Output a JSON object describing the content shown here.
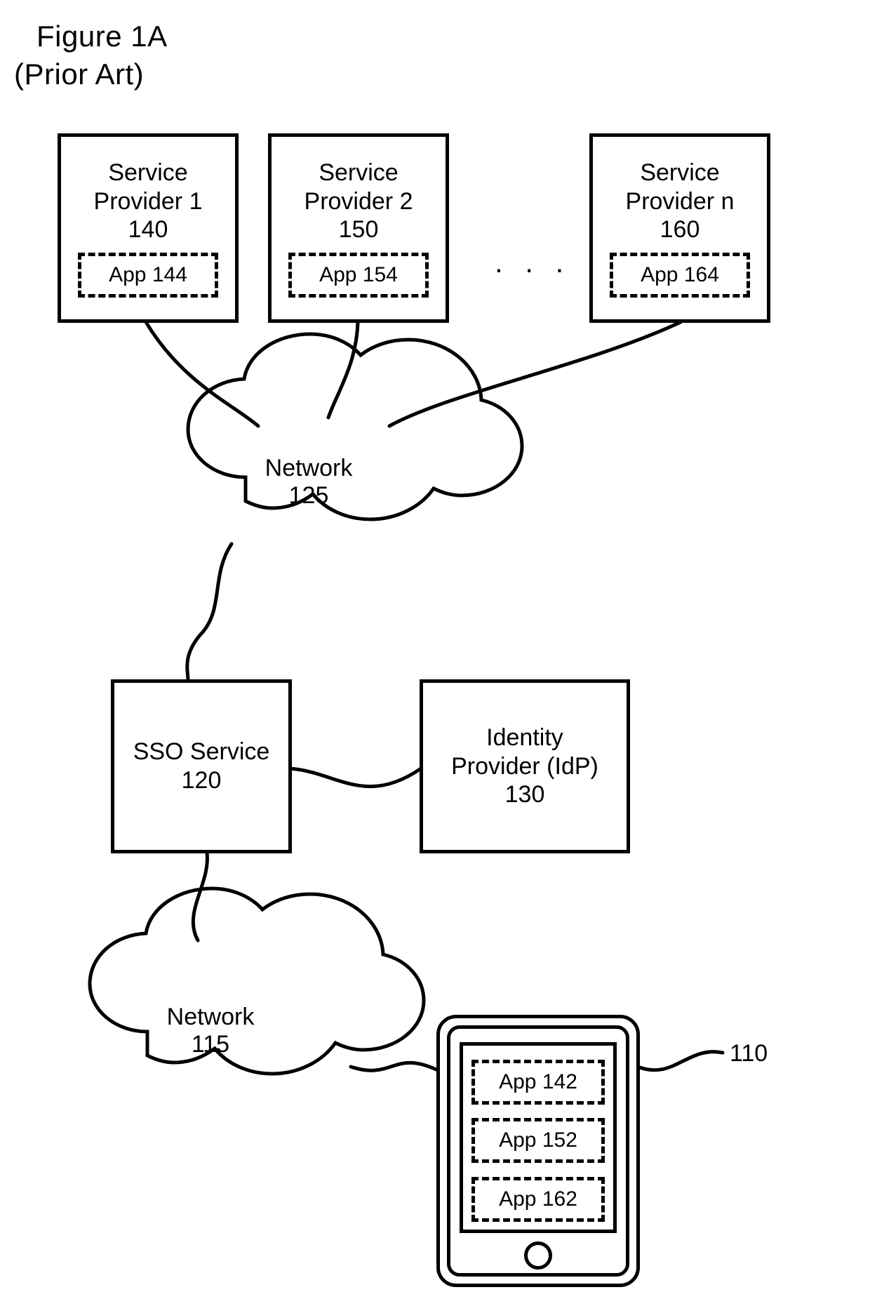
{
  "title": {
    "line1": "Figure 1A",
    "line2": "(Prior Art)"
  },
  "sp1": {
    "l1": "Service",
    "l2": "Provider 1",
    "num": "140",
    "app": "App 144"
  },
  "sp2": {
    "l1": "Service",
    "l2": "Provider 2",
    "num": "150",
    "app": "App 154"
  },
  "spn": {
    "l1": "Service",
    "l2": "Provider n",
    "num": "160",
    "app": "App 164"
  },
  "ellipsis": ". . .",
  "net125": {
    "l1": "Network",
    "l2": "125"
  },
  "net115": {
    "l1": "Network",
    "l2": "115"
  },
  "sso": {
    "l1": "SSO Service",
    "l2": "120"
  },
  "idp": {
    "l1": "Identity",
    "l2": "Provider (IdP)",
    "l3": "130"
  },
  "phone": {
    "app1": "App 142",
    "app2": "App 152",
    "app3": "App 162",
    "leader": "110"
  }
}
